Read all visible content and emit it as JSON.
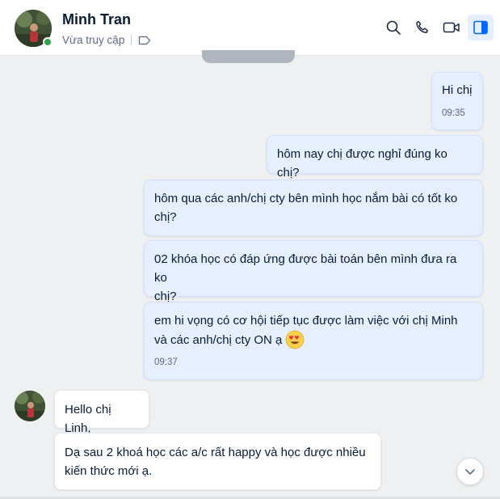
{
  "header": {
    "contact_name": "Minh Tran",
    "status": "Vừa truy cập",
    "actions": [
      {
        "icon": "search-icon"
      },
      {
        "icon": "phone-icon"
      },
      {
        "icon": "video-icon"
      },
      {
        "icon": "sidebar-panel-icon",
        "active": true
      }
    ]
  },
  "messages": [
    {
      "direction": "sent",
      "lines": [
        "Hi chị"
      ],
      "time": "09:35"
    },
    {
      "direction": "sent",
      "lines": [
        "hôm nay chị được nghỉ đúng ko chị?"
      ]
    },
    {
      "direction": "sent",
      "lines": [
        "hôm qua các anh/chị cty bên mình học nắm bài có tốt ko",
        "chị?"
      ]
    },
    {
      "direction": "sent",
      "lines": [
        "02 khóa học có đáp ứng được bài toán bên mình đưa ra ko",
        "chị?"
      ]
    },
    {
      "direction": "sent",
      "lines": [
        "em hi vọng có cơ hội tiếp tục được làm việc với chị Minh",
        "và các anh/chị cty ON ạ"
      ],
      "emoji": "heart-eyes-emoji",
      "time": "09:37"
    },
    {
      "direction": "received",
      "lines": [
        "Hello chị Linh,"
      ]
    },
    {
      "direction": "received",
      "lines": [
        "Dạ sau 2 khoá học các a/c rất happy và học được nhiều",
        "kiến thức mới ạ."
      ]
    }
  ],
  "colors": {
    "sent_bubble": "#e5efff",
    "received_bubble": "#ffffff",
    "background": "#eef0f1",
    "online": "#30a24a",
    "accent": "#0068ff"
  }
}
